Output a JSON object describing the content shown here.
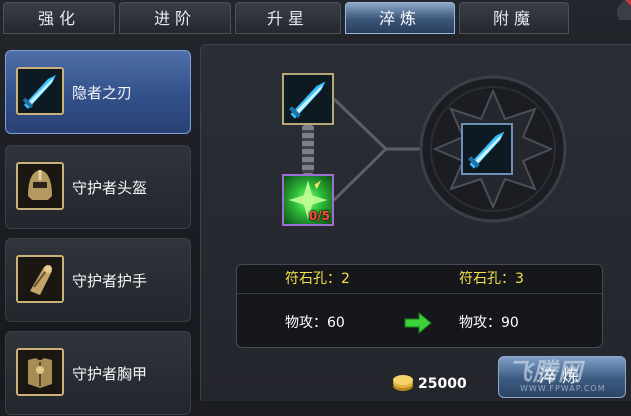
{
  "tabs": [
    {
      "label": "强化"
    },
    {
      "label": "进阶"
    },
    {
      "label": "升星"
    },
    {
      "label": "淬炼"
    },
    {
      "label": "附魔"
    }
  ],
  "active_tab": "淬炼",
  "items": [
    {
      "name": "隐者之刃",
      "icon": "blade-icon"
    },
    {
      "name": "守护者头盔",
      "icon": "helmet-icon"
    },
    {
      "name": "守护者护手",
      "icon": "gauntlet-icon"
    },
    {
      "name": "守护者胸甲",
      "icon": "chestplate-icon"
    }
  ],
  "refine": {
    "base_item_icon": "blade-icon",
    "stone_icon": "rune-stone-icon",
    "stone_count": "0/5",
    "result_item_icon": "blade-icon"
  },
  "info": {
    "before_holes": "符石孔：2",
    "after_holes": "符石孔：3",
    "before_atk": "物攻：60",
    "after_atk": "物攻：90"
  },
  "cost": {
    "icon": "gold-coin-icon",
    "value": "25000"
  },
  "refine_button": "淬炼",
  "watermark": {
    "text": "飞腾网",
    "sub": "WWW.FPWAP.COM"
  },
  "colors": {
    "accent": "#3a5578",
    "gold": "#f1e14a",
    "stone_warning": "#ff4a3a"
  }
}
